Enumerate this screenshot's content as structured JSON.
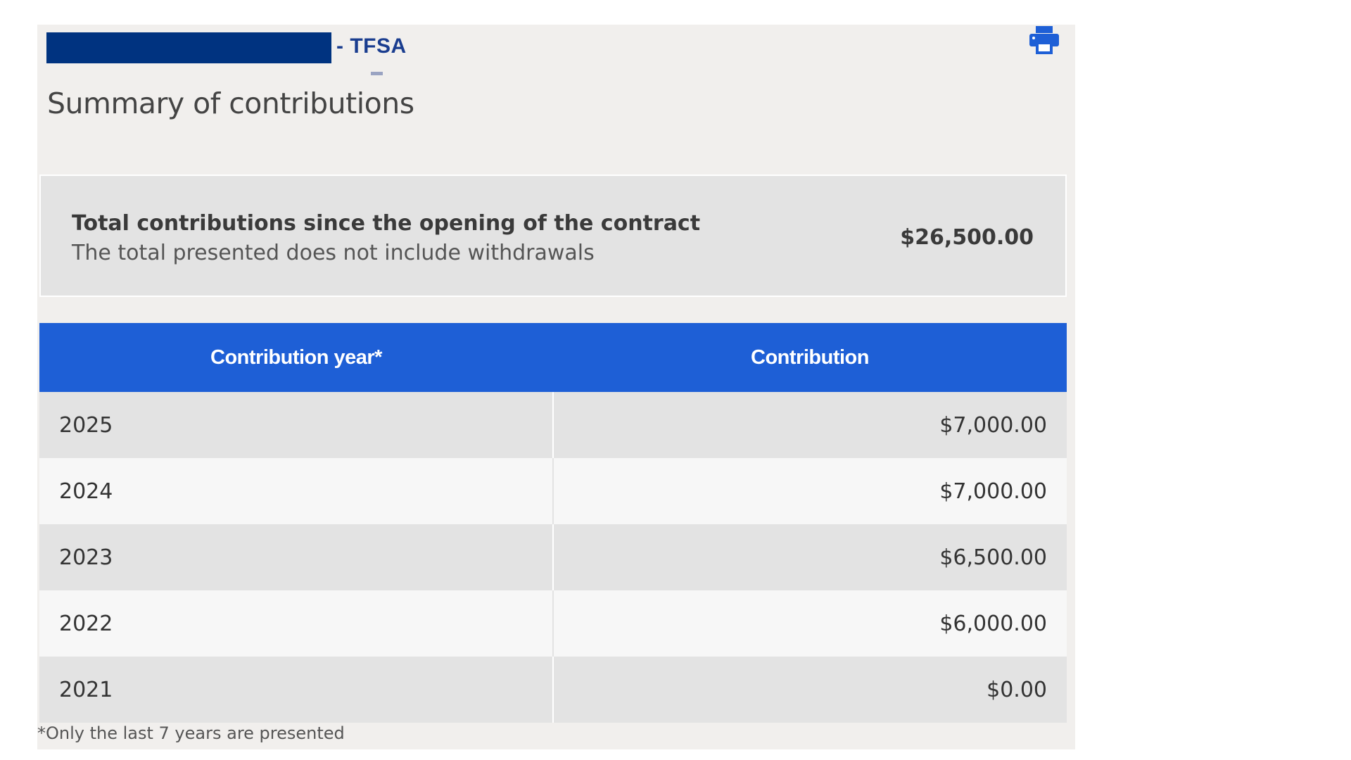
{
  "header": {
    "account_suffix": "- TFSA",
    "title": "Summary of contributions",
    "print_icon": "printer-icon",
    "accent_color": "#1e5fd6",
    "redaction_color": "#003380"
  },
  "total": {
    "title": "Total contributions since the opening of the contract",
    "note": "The total presented does not include withdrawals",
    "amount": "$26,500.00"
  },
  "table": {
    "columns": [
      "Contribution year*",
      "Contribution"
    ],
    "rows": [
      {
        "year": "2025",
        "contribution": "$7,000.00"
      },
      {
        "year": "2024",
        "contribution": "$7,000.00"
      },
      {
        "year": "2023",
        "contribution": "$6,500.00"
      },
      {
        "year": "2022",
        "contribution": "$6,000.00"
      },
      {
        "year": "2021",
        "contribution": "$0.00"
      }
    ]
  },
  "footnote": "*Only the last 7 years are presented"
}
